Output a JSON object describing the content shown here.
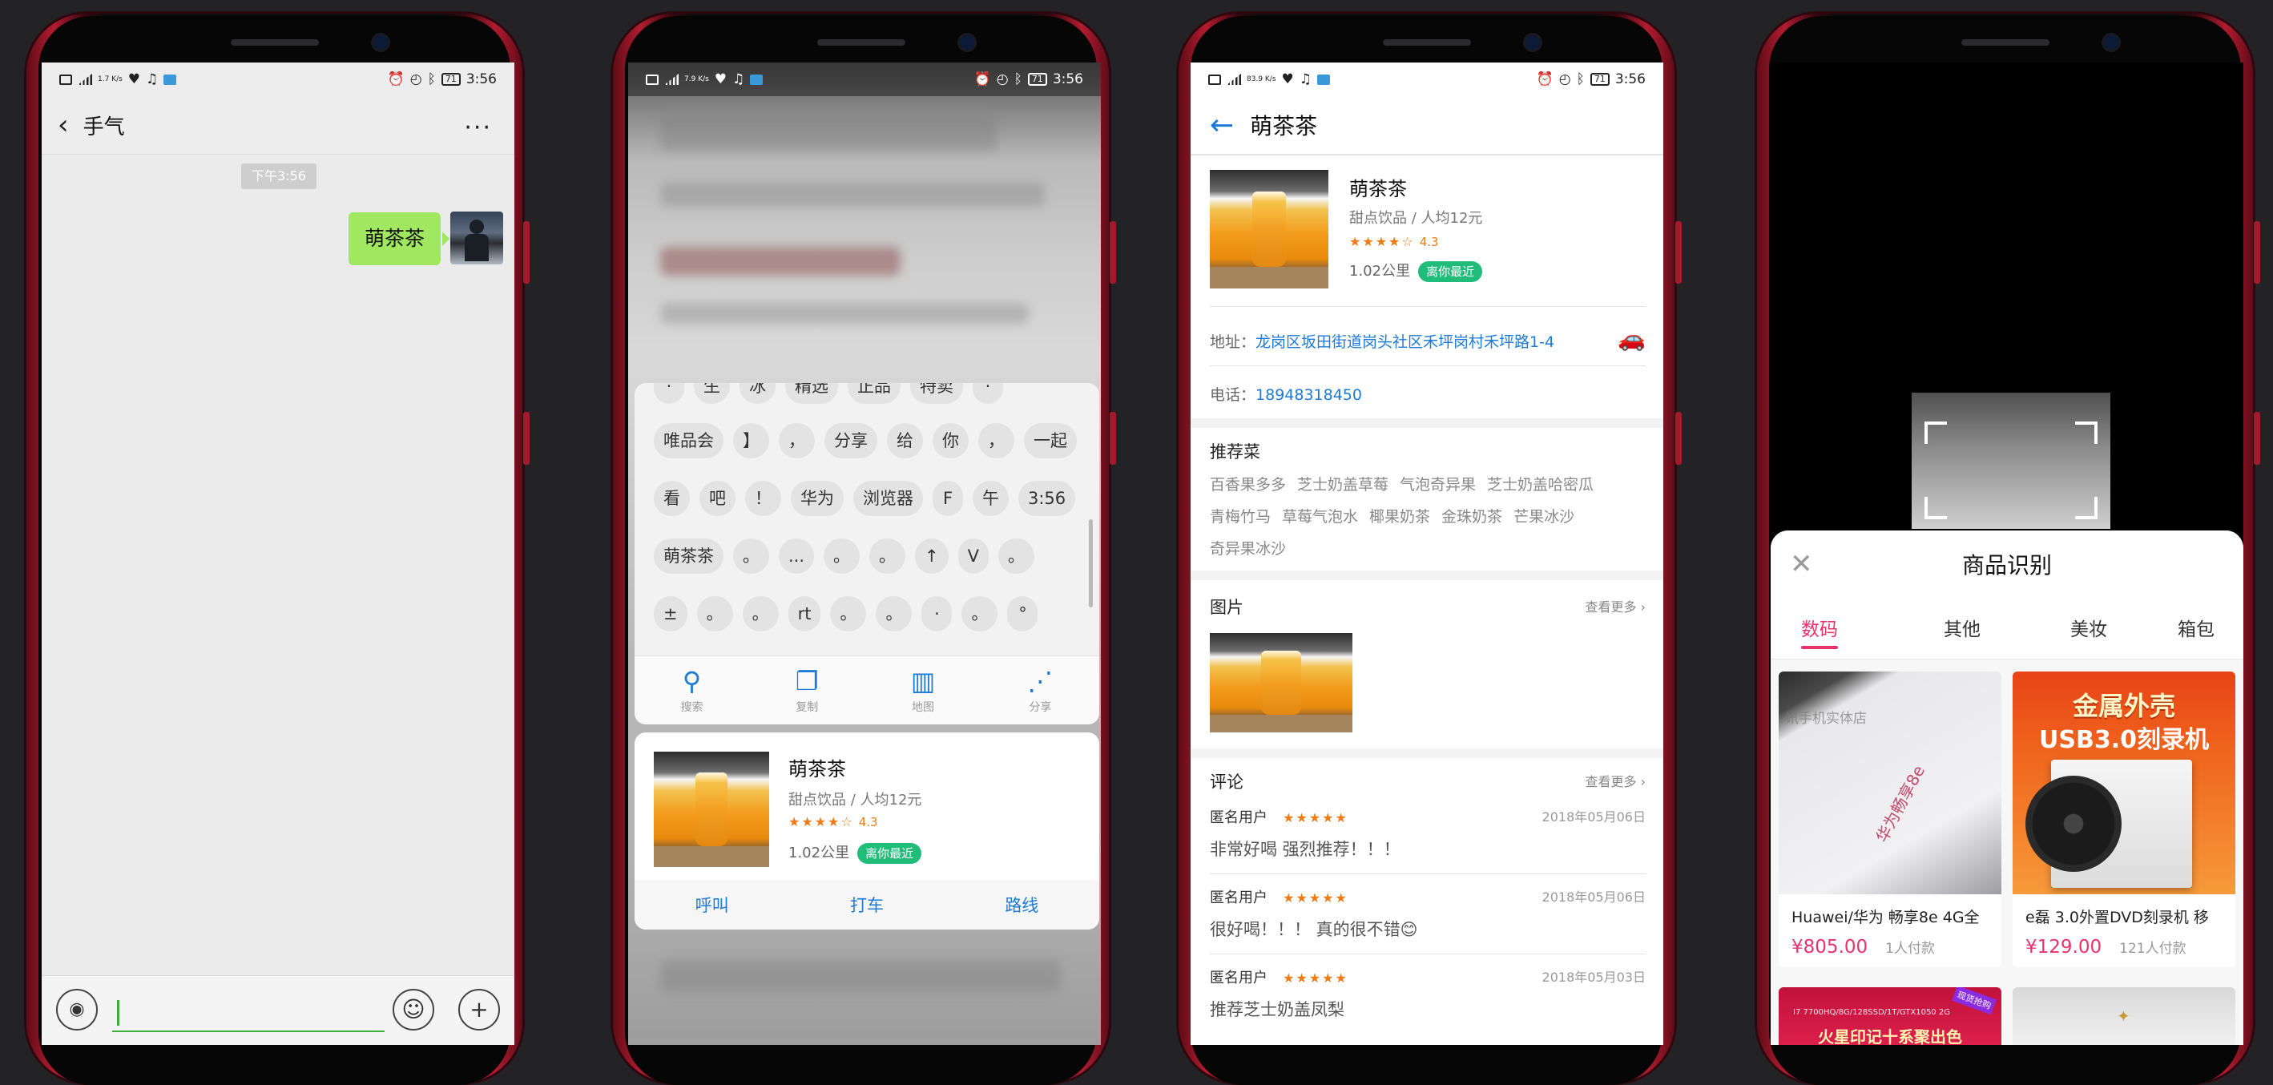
{
  "status": {
    "time": "3:56",
    "battery": "71",
    "speed1": "1.7 K/s",
    "speed2": "7.9 K/s",
    "speed3": "83.9 K/s"
  },
  "s1": {
    "title": "手气",
    "time_tag": "下午3:56",
    "message": "萌茶茶"
  },
  "s2": {
    "chips_row0": [
      "·",
      "生",
      "冰",
      "精选",
      "正品",
      "特卖",
      "·"
    ],
    "chips_row1": [
      "唯品会",
      "】",
      "，",
      "分享",
      "给",
      "你",
      "，",
      "一起"
    ],
    "chips_row2": [
      "看",
      "吧",
      "！",
      "华为",
      "浏览器",
      "F",
      "午",
      "3:56"
    ],
    "chips_row3": [
      "萌茶茶",
      "。",
      "...",
      "。",
      "。",
      "↑",
      "V",
      "。"
    ],
    "chips_row4": [
      "±",
      "。",
      "。",
      "rt",
      "。",
      "。",
      "·",
      "。",
      "°"
    ],
    "actions": [
      {
        "icon": "search-icon",
        "label": "搜索"
      },
      {
        "icon": "copy-icon",
        "label": "复制"
      },
      {
        "icon": "map-icon",
        "label": "地图"
      },
      {
        "icon": "share-icon",
        "label": "分享"
      }
    ],
    "buttons": [
      "呼叫",
      "打车",
      "路线"
    ]
  },
  "shop": {
    "name": "萌茶茶",
    "category": "甜点饮品 / 人均12元",
    "stars": "★★★★☆",
    "rating": "4.3",
    "distance": "1.02公里",
    "nearest": "离你最近",
    "address_label": "地址：",
    "address": "龙岗区坂田街道岗头社区禾坪岗村禾坪路1-4",
    "phone_label": "电话：",
    "phone": "18948318450",
    "dishes_title": "推荐菜",
    "dishes_row1": [
      "百香果多多",
      "芝士奶盖草莓",
      "气泡奇异果",
      "芝士奶盖哈密瓜"
    ],
    "dishes_row2": [
      "青梅竹马",
      "草莓气泡水",
      "椰果奶茶",
      "金珠奶茶",
      "芒果冰沙"
    ],
    "dishes_row3": [
      "奇异果冰沙"
    ],
    "pics_title": "图片",
    "see_more": "查看更多 ›",
    "reviews_title": "评论",
    "reviews": [
      {
        "user": "匿名用户",
        "stars": "★★★★★",
        "date": "2018年05月06日",
        "text": "非常好喝 强烈推荐！！！"
      },
      {
        "user": "匿名用户",
        "stars": "★★★★★",
        "date": "2018年05月06日",
        "text": "很好喝！！！ 真的很不错😊"
      },
      {
        "user": "匿名用户",
        "stars": "★★★★★",
        "date": "2018年05月03日",
        "text": "推荐芝士奶盖凤梨"
      }
    ]
  },
  "s4": {
    "panel_title": "商品识别",
    "tabs": [
      "数码",
      "其他",
      "美妆",
      "箱包"
    ],
    "products": [
      {
        "watermark": "讯手机实体店",
        "box_text": "华为畅享8e",
        "title": "Huawei/华为 畅享8e 4G全",
        "price": "¥805.00",
        "paid": "1人付款"
      },
      {
        "banner1": "金属外壳",
        "banner2": "USB3.0刻录机",
        "title": "e磊 3.0外置DVD刻录机 移",
        "price": "¥129.00",
        "paid": "121人付款"
      }
    ],
    "partial_banner": "火星印记十系聚出色",
    "partial_sub": "I7 7700HQ/8G/128SSD/1T/GTX1050 2G",
    "partial_tag": "现货抢购"
  }
}
